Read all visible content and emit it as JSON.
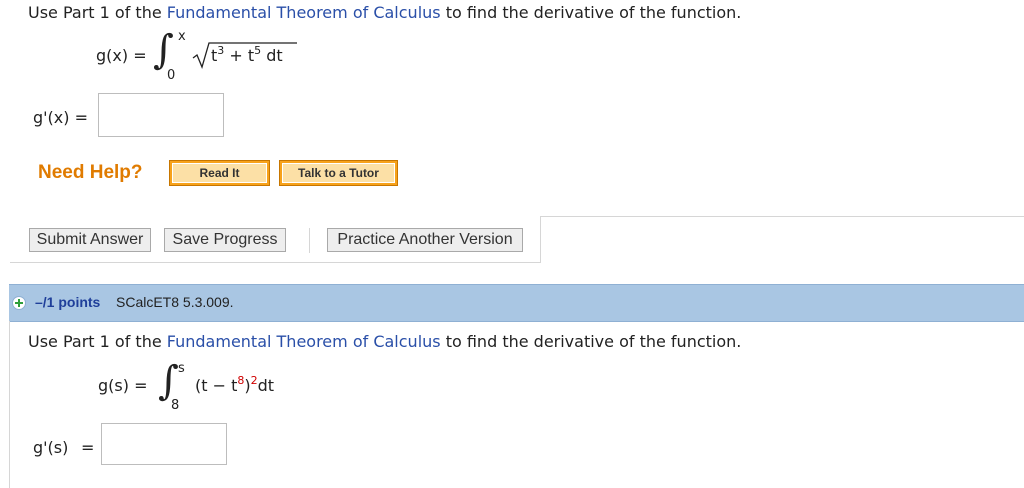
{
  "question1": {
    "instruction_prefix": "Use Part 1 of the",
    "instruction_link": "Fundamental Theorem of Calculus",
    "instruction_suffix": "to find the derivative of the function.",
    "function_lhs": "g(x) =",
    "upper_limit": "x",
    "lower_limit": "0",
    "integrand_t": "t",
    "integrand_exp1": "3",
    "integrand_plus": " + t",
    "integrand_exp2": "5",
    "integrand_dt": " dt",
    "answer_label": "g'(x) =",
    "answer_value": ""
  },
  "help": {
    "label": "Need Help?",
    "read_it": "Read It",
    "talk_to_tutor": "Talk to a Tutor"
  },
  "actions": {
    "submit": "Submit Answer",
    "save": "Save Progress",
    "practice": "Practice Another Version"
  },
  "question2": {
    "points": "–/1 points",
    "code": "SCalcET8 5.3.009.",
    "instruction_prefix": "Use Part 1 of the",
    "instruction_link": "Fundamental Theorem of Calculus",
    "instruction_suffix": "to find the derivative of the function.",
    "function_lhs": "g(s) =",
    "upper_limit": "s",
    "lower_limit": "8",
    "integrand_open": "(t − t",
    "integrand_exp_inner": "8",
    "integrand_close": ")",
    "integrand_exp_outer": "2",
    "integrand_dt": "dt",
    "answer_label": "g'(s)",
    "answer_eq": "=",
    "answer_value": ""
  },
  "colors": {
    "link": "#2a4fa8",
    "need_help": "#e07b00",
    "header_bar": "#a9c6e3",
    "red_limit": "#d00000",
    "expand_icon": "#2e9e3a"
  },
  "icons": {
    "expand": "plus-circle-icon",
    "sqrt": "square-root-symbol",
    "integral": "integral-symbol"
  }
}
